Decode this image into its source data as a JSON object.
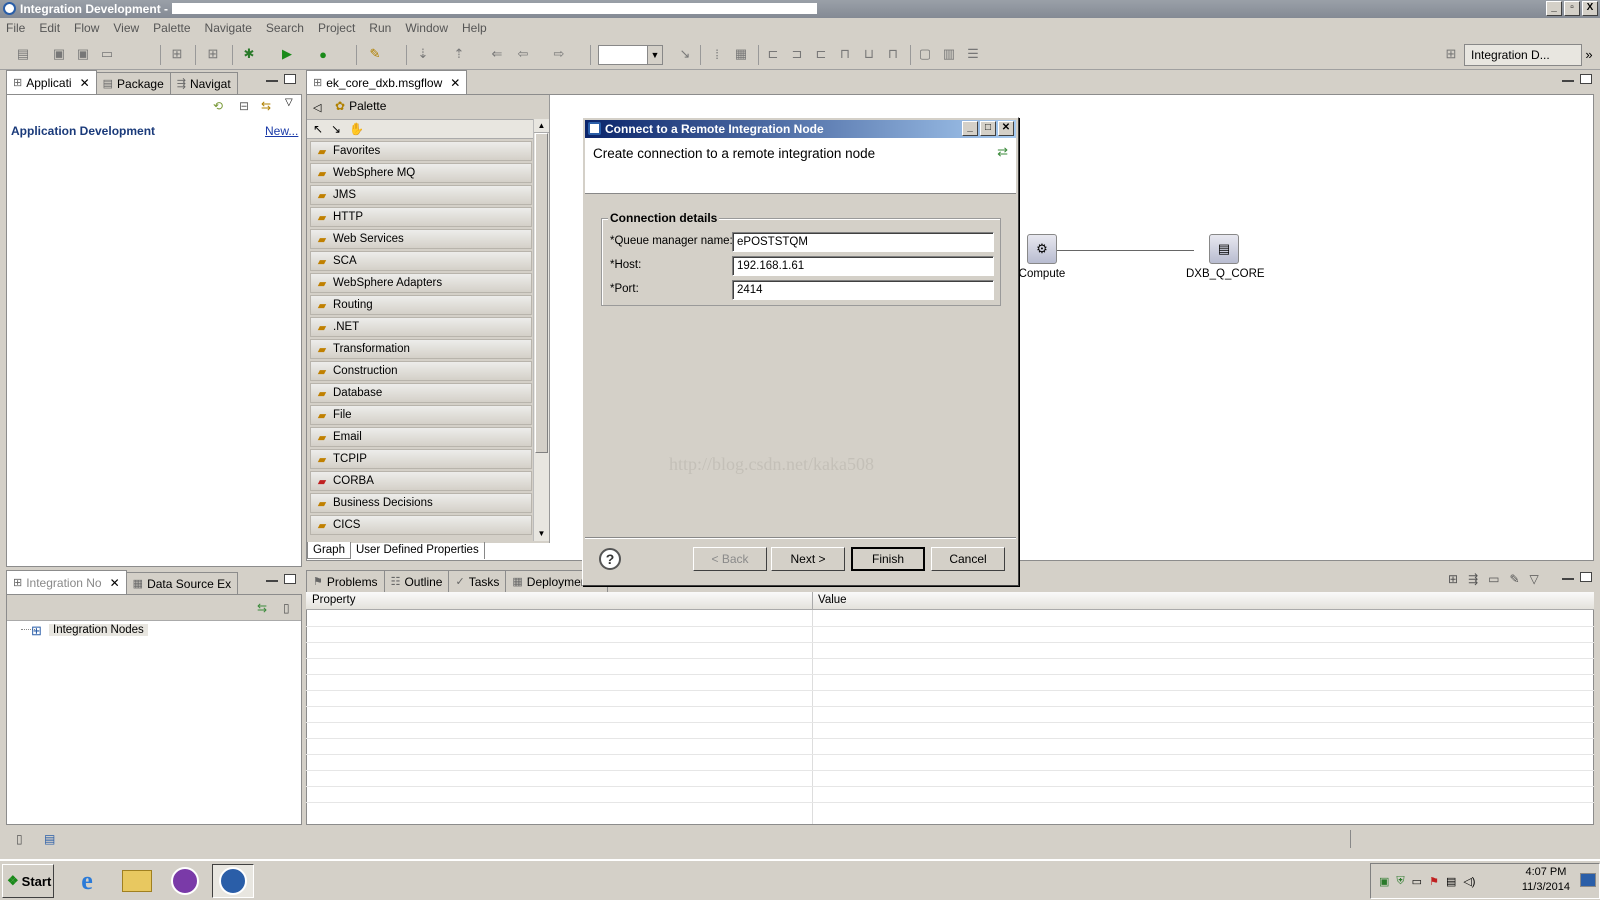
{
  "window": {
    "title": "Integration Development - ",
    "min": "_",
    "max": "▫",
    "close": "X"
  },
  "menu": [
    "File",
    "Edit",
    "Flow",
    "View",
    "Palette",
    "Navigate",
    "Search",
    "Project",
    "Run",
    "Window",
    "Help"
  ],
  "toolbar": {
    "perspective_label": "Integration D...",
    "overflow": "»"
  },
  "left_top": {
    "tabs": [
      {
        "label": "Applicati"
      },
      {
        "label": "Package"
      },
      {
        "label": "Navigat"
      }
    ],
    "heading": "Application Development",
    "new_link": "New..."
  },
  "left_bottom": {
    "tabs": [
      {
        "label": "Integration No"
      },
      {
        "label": "Data Source Ex"
      }
    ],
    "tree_item": "Integration Nodes"
  },
  "editor": {
    "tab_label": "ek_core_dxb.msgflow",
    "palette_header": "Palette",
    "palette_items": [
      "Favorites",
      "WebSphere MQ",
      "JMS",
      "HTTP",
      "Web Services",
      "SCA",
      "WebSphere Adapters",
      "Routing",
      ".NET",
      "Transformation",
      "Construction",
      "Database",
      "File",
      "Email",
      "TCPIP",
      "CORBA",
      "Business Decisions",
      "CICS"
    ],
    "bottom_tabs": [
      "Graph",
      "User Defined Properties"
    ],
    "nodes": [
      {
        "label": "Compute"
      },
      {
        "label": "DXB_Q_CORE"
      }
    ]
  },
  "bottom_panel": {
    "tabs": [
      "Problems",
      "Outline",
      "Tasks",
      "Deployment L"
    ],
    "columns": [
      "Property",
      "Value"
    ]
  },
  "dialog": {
    "title": "Connect to a Remote Integration Node",
    "heading": "Create connection to a remote integration node",
    "group_label": "Connection details",
    "fields": [
      {
        "label": "*Queue manager name:",
        "value": "ePOSTSTQM"
      },
      {
        "label": "*Host:",
        "value": "192.168.1.61"
      },
      {
        "label": "*Port:",
        "value": "2414"
      }
    ],
    "watermark": "http://blog.csdn.net/kaka508",
    "help": "?",
    "buttons": {
      "back": "< Back",
      "next": "Next >",
      "finish": "Finish",
      "cancel": "Cancel"
    }
  },
  "taskbar": {
    "start_label": "Start",
    "time": "4:07 PM",
    "date": "11/3/2014"
  }
}
